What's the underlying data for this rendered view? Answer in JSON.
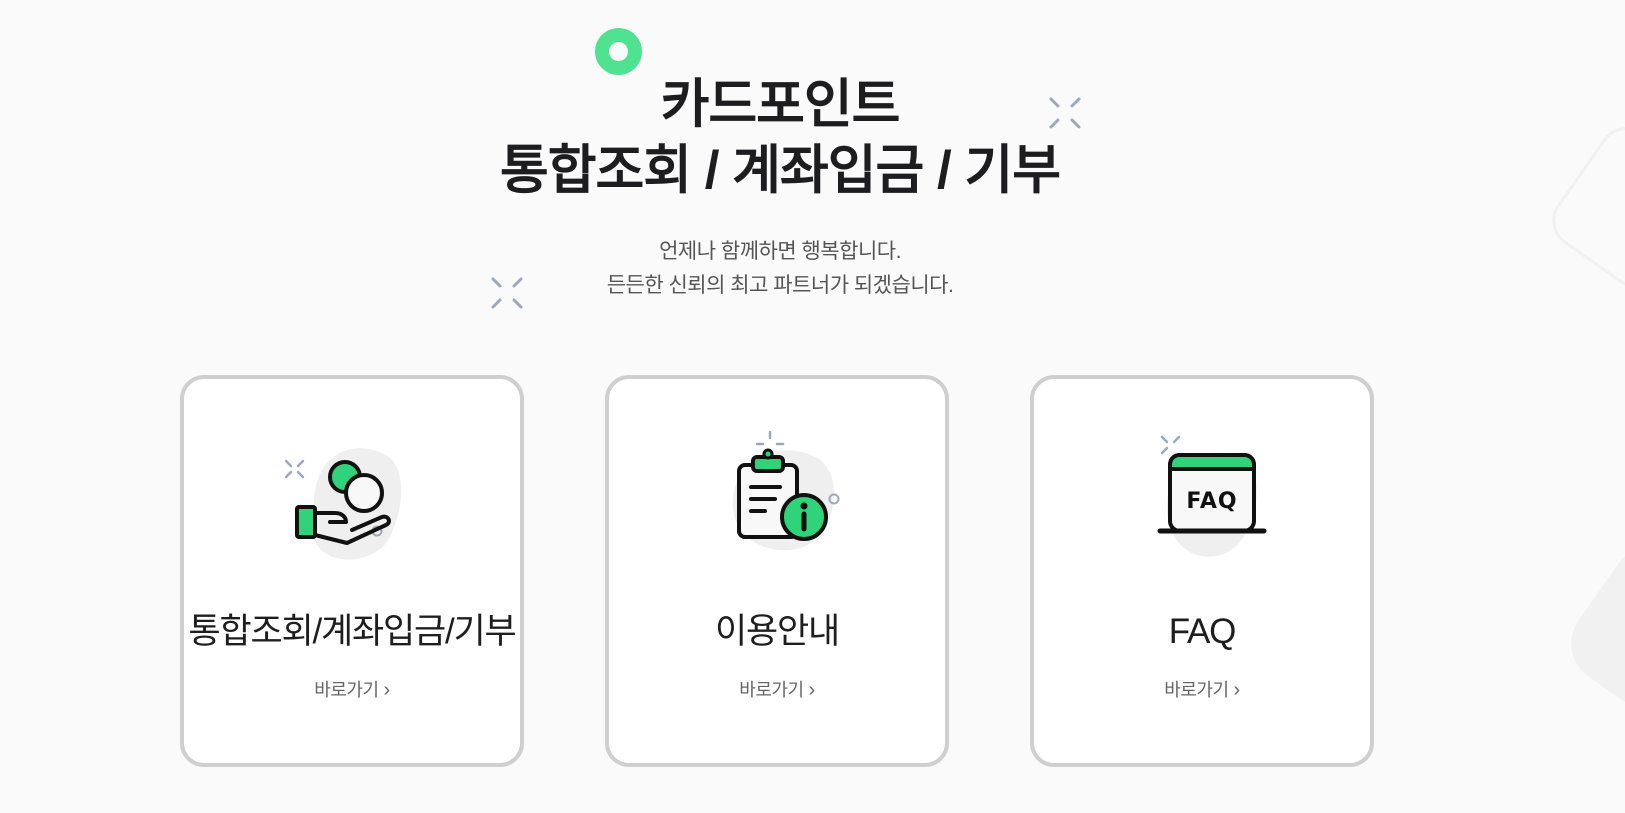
{
  "hero": {
    "title_line_1": "카드포인트",
    "title_line_2": "통합조회 / 계좌입금 / 기부",
    "subtitle_line_1": "언제나 함께하면 행복합니다.",
    "subtitle_line_2": "든든한 신뢰의 최고 파트너가 되겠습니다."
  },
  "cards": [
    {
      "title": "통합조회/계좌입금/기부",
      "link_label": "바로가기",
      "icon": "coin-hand-icon"
    },
    {
      "title": "이용안내",
      "link_label": "바로가기",
      "icon": "clipboard-info-icon"
    },
    {
      "title": "FAQ",
      "link_label": "바로가기",
      "icon": "faq-board-icon"
    }
  ],
  "colors": {
    "accent": "#4fe391",
    "icon_green": "#2fd37a",
    "card_border": "#cfcfcf",
    "background": "#fafafa"
  }
}
